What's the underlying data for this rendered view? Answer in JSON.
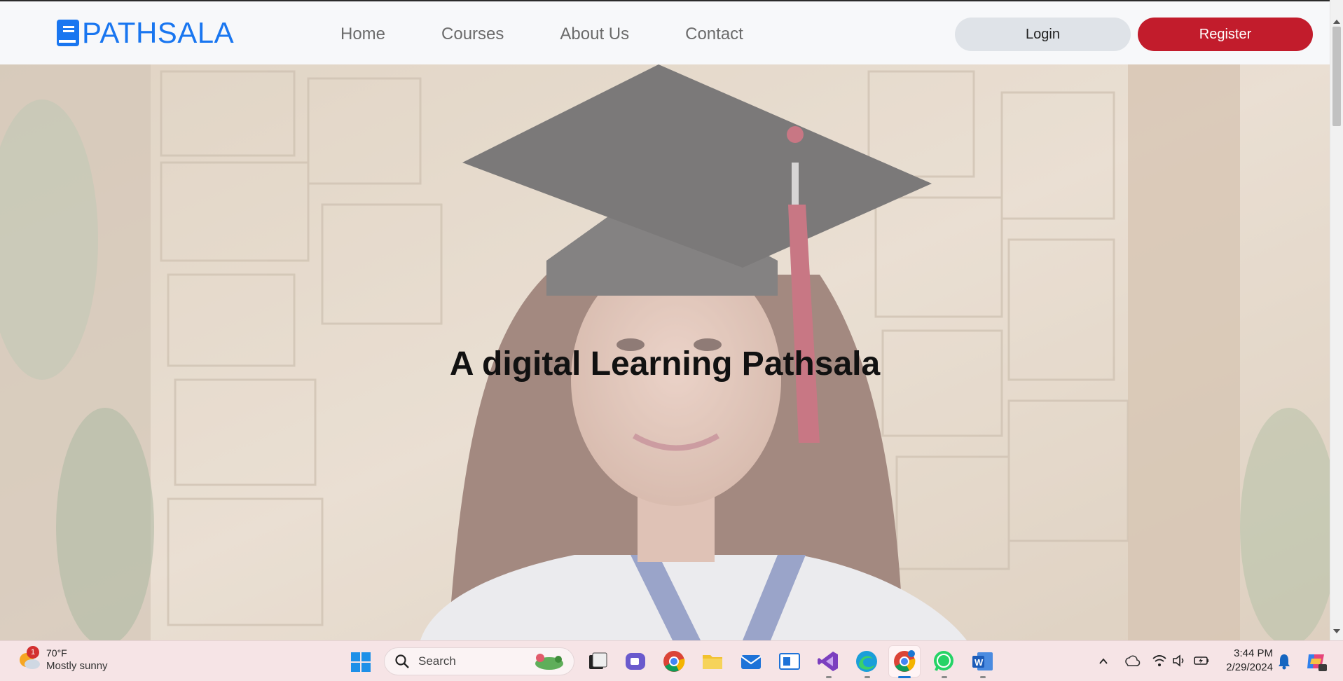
{
  "navbar": {
    "brand": "PATHSALA",
    "brand_icon": "book-icon",
    "links": [
      "Home",
      "Courses",
      "About Us",
      "Contact"
    ],
    "login_label": "Login",
    "register_label": "Register",
    "colors": {
      "brand": "#1976f0",
      "register": "#c21c2c",
      "login": "#dfe3e8"
    }
  },
  "hero": {
    "title": "A digital Learning Pathsala"
  },
  "taskbar": {
    "weather": {
      "badge": "1",
      "temperature": "70°F",
      "description": "Mostly sunny"
    },
    "search_label": "Search",
    "apps": [
      "task-view",
      "teams-meet",
      "chrome",
      "file-explorer",
      "mail",
      "news",
      "visual-studio",
      "edge",
      "chrome-profile",
      "whatsapp",
      "word"
    ],
    "clock": {
      "time": "3:44 PM",
      "date": "2/29/2024"
    }
  }
}
